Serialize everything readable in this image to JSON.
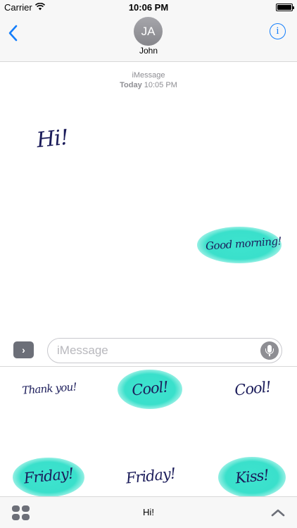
{
  "status_bar": {
    "carrier": "Carrier",
    "time": "10:06 PM",
    "battery_level": 1.0
  },
  "header": {
    "avatar_initials": "JA",
    "contact_name": "John",
    "back_icon": "chevron-left-icon",
    "info_icon": "info-icon",
    "info_glyph": "i"
  },
  "conversation": {
    "service_label": "iMessage",
    "timestamp_day": "Today",
    "timestamp_time": "10:05 PM",
    "messages": [
      {
        "from": "them",
        "sticker_text": "Hi!"
      },
      {
        "from": "me",
        "sticker_text": "Good morning!"
      }
    ]
  },
  "input_bar": {
    "apps_glyph": "›",
    "placeholder": "iMessage",
    "value": ""
  },
  "sticker_drawer": {
    "stickers": [
      {
        "text": "Thank you!",
        "highlight": false
      },
      {
        "text": "Cool!",
        "highlight": true
      },
      {
        "text": "Cool!",
        "highlight": false
      },
      {
        "text": "Friday!",
        "highlight": true
      },
      {
        "text": "Friday!",
        "highlight": false
      },
      {
        "text": "Kiss!",
        "highlight": true
      }
    ]
  },
  "bottom_bar": {
    "pack_name": "Hi!",
    "grid_icon": "app-grid-icon",
    "collapse_icon": "chevron-up-icon"
  },
  "colors": {
    "accent": "#147efb",
    "sticker_text": "#1b1c5a",
    "sticker_highlight": "#3de3cf",
    "bar_background": "#f7f7f7"
  }
}
